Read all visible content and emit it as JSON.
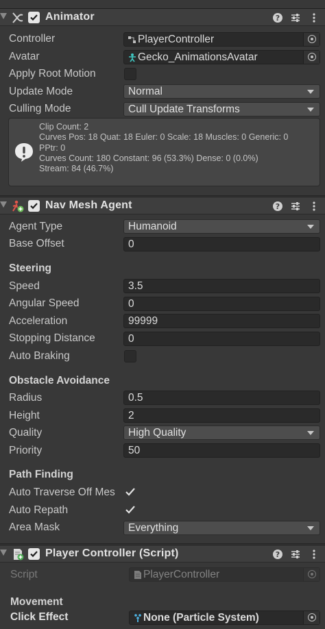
{
  "animator": {
    "title": "Animator",
    "fields": {
      "controller_label": "Controller",
      "controller_value": "PlayerController",
      "avatar_label": "Avatar",
      "avatar_value": "Gecko_AnimationsAvatar",
      "apply_root_motion_label": "Apply Root Motion",
      "apply_root_motion_checked": false,
      "update_mode_label": "Update Mode",
      "update_mode_value": "Normal",
      "culling_mode_label": "Culling Mode",
      "culling_mode_value": "Cull Update Transforms"
    },
    "info": {
      "line1": "Clip Count: 2",
      "line2": "Curves Pos: 18 Quat: 18 Euler: 0 Scale: 18 Muscles: 0 Generic: 0",
      "line3": "PPtr: 0",
      "line4": "Curves Count: 180 Constant: 96 (53.3%) Dense: 0 (0.0%)",
      "line5": "Stream: 84 (46.7%)"
    }
  },
  "nav_mesh_agent": {
    "title": "Nav Mesh Agent",
    "agent_type_label": "Agent Type",
    "agent_type_value": "Humanoid",
    "base_offset_label": "Base Offset",
    "base_offset_value": "0",
    "steering": {
      "heading": "Steering",
      "speed_label": "Speed",
      "speed_value": "3.5",
      "angular_speed_label": "Angular Speed",
      "angular_speed_value": "0",
      "acceleration_label": "Acceleration",
      "acceleration_value": "99999",
      "stopping_distance_label": "Stopping Distance",
      "stopping_distance_value": "0",
      "auto_braking_label": "Auto Braking",
      "auto_braking_checked": false
    },
    "obstacle_avoidance": {
      "heading": "Obstacle Avoidance",
      "radius_label": "Radius",
      "radius_value": "0.5",
      "height_label": "Height",
      "height_value": "2",
      "quality_label": "Quality",
      "quality_value": "High Quality",
      "priority_label": "Priority",
      "priority_value": "50"
    },
    "path_finding": {
      "heading": "Path Finding",
      "auto_traverse_label": "Auto Traverse Off Mes",
      "auto_traverse_checked": true,
      "auto_repath_label": "Auto Repath",
      "auto_repath_checked": true,
      "area_mask_label": "Area Mask",
      "area_mask_value": "Everything"
    }
  },
  "player_controller": {
    "title": "Player Controller (Script)",
    "script_label": "Script",
    "script_value": "PlayerController",
    "movement_heading": "Movement",
    "click_effect_label": "Click Effect",
    "click_effect_value": "None (Particle System)"
  },
  "colors": {
    "background": "#383838",
    "header": "#3e3e3e",
    "field": "#2a2a2a",
    "dropdown": "#4d4d4d"
  }
}
